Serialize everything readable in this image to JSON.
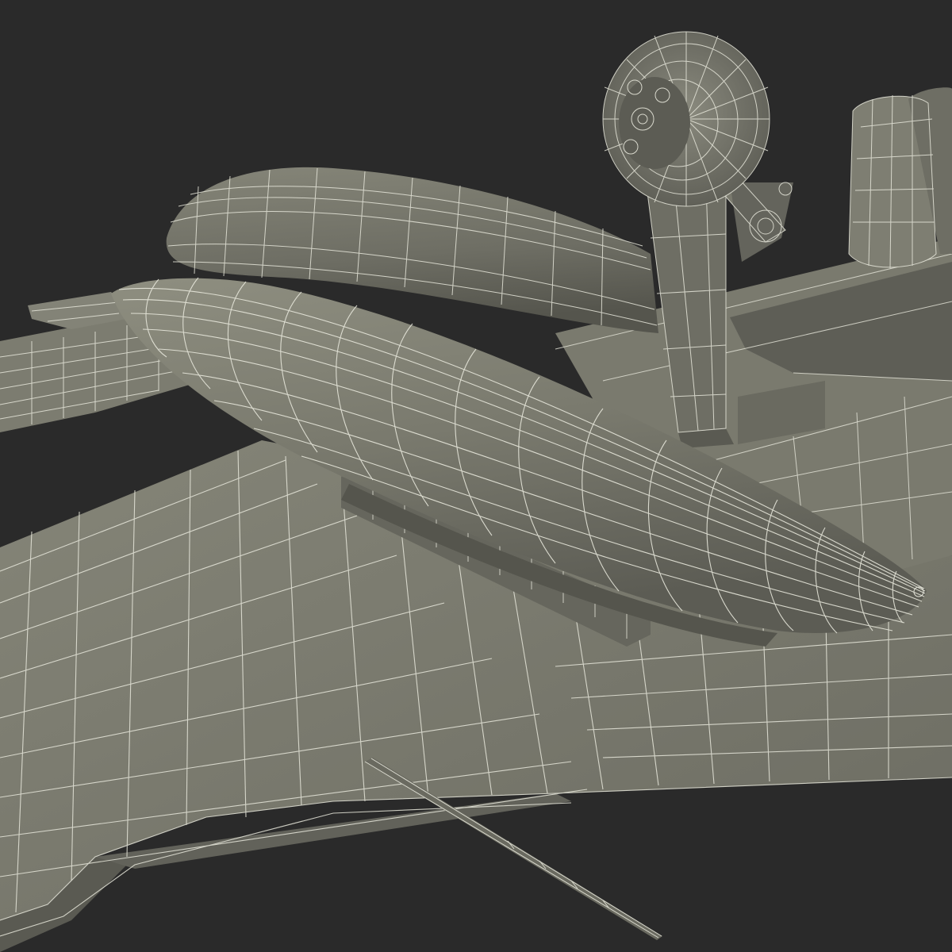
{
  "colors": {
    "background": "#2a2a2a",
    "surface_light": "#8a8a7c",
    "surface_mid": "#76766a",
    "surface_dark": "#5a5a52",
    "surface_shadow": "#45453f",
    "wireframe": "#e6e6da"
  },
  "subject": {
    "parts": [
      "wing-left-forward",
      "wing-main",
      "tail-boom",
      "drop-tank-rear",
      "drop-tank-front",
      "pylon",
      "landing-gear-wheel",
      "landing-gear-strut",
      "cockpit-seat",
      "pitot-probe"
    ]
  }
}
